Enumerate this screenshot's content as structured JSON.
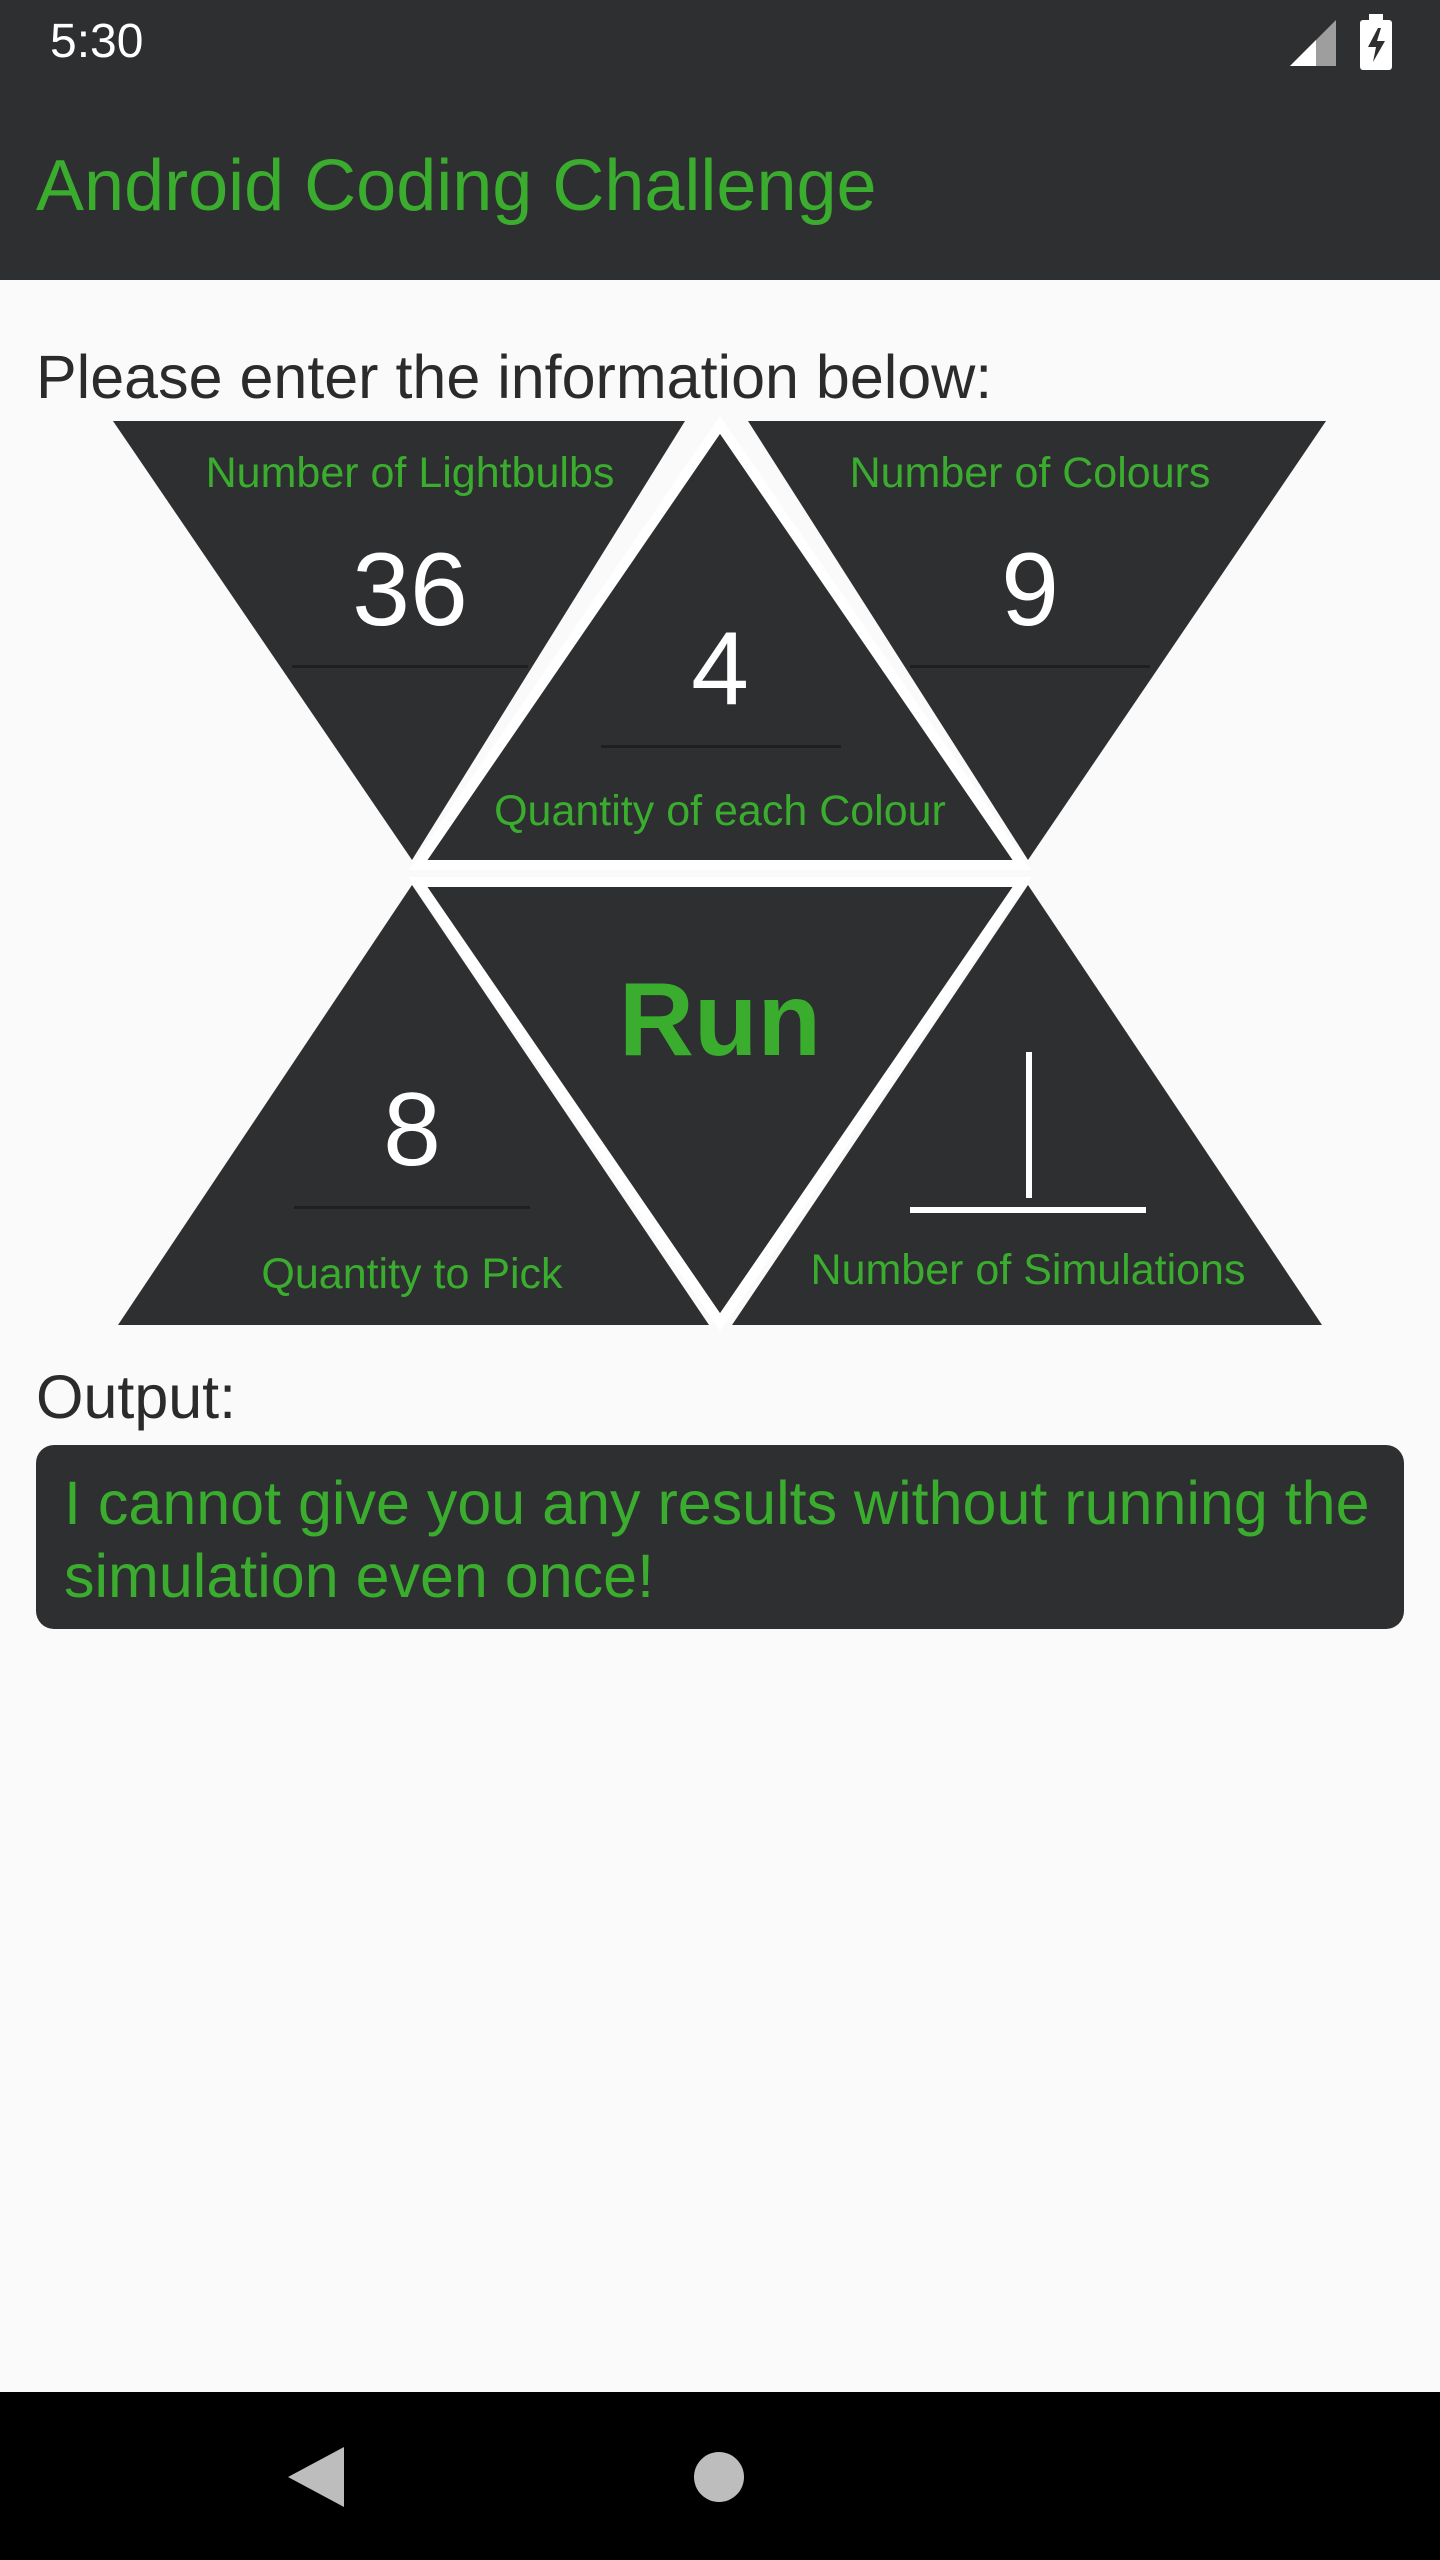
{
  "status_bar": {
    "time": "5:30",
    "signal_icon": "cellular-signal-icon",
    "battery_icon": "battery-charging-icon"
  },
  "app_bar": {
    "title": "Android Coding Challenge"
  },
  "form": {
    "prompt": "Please enter the information below:",
    "fields": {
      "lightbulbs": {
        "label": "Number of Lightbulbs",
        "value": "36"
      },
      "colours": {
        "label": "Number of Colours",
        "value": "9"
      },
      "each_colour": {
        "label": "Quantity of each Colour",
        "value": "4"
      },
      "pick": {
        "label": "Quantity to Pick",
        "value": "8"
      },
      "simulations": {
        "label": "Number of Simulations",
        "value": ""
      }
    },
    "run_label": "Run"
  },
  "output": {
    "label": "Output:",
    "text": "I cannot give you any results without running the simulation even once!"
  },
  "nav_bar": {
    "back_icon": "back-triangle-icon",
    "home_icon": "home-circle-icon"
  },
  "colors": {
    "accent": "#3aad2e",
    "panel": "#2e2f31",
    "background": "#fafafa"
  }
}
